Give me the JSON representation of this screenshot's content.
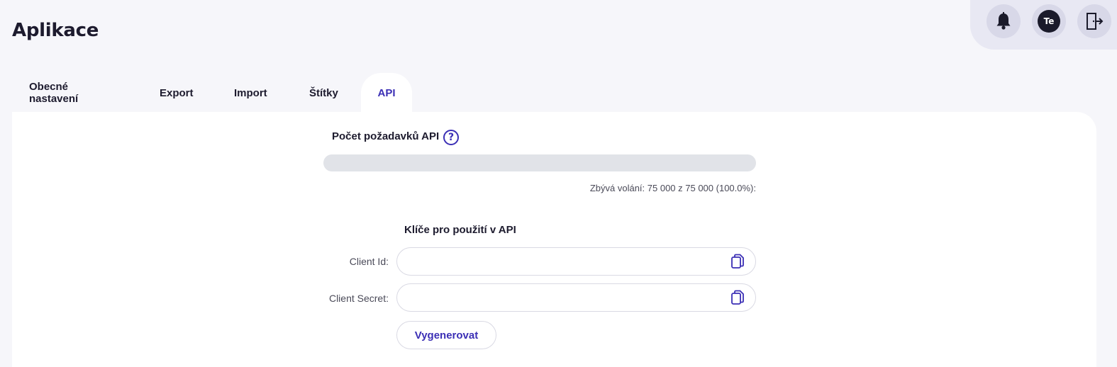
{
  "page": {
    "title": "Aplikace"
  },
  "header": {
    "user_initials": "Te",
    "icons": [
      "bell-icon",
      "avatar",
      "logout-icon"
    ]
  },
  "tabs": [
    {
      "label": "Obecné nastavení",
      "active": false
    },
    {
      "label": "Export",
      "active": false
    },
    {
      "label": "Import",
      "active": false
    },
    {
      "label": "Štítky",
      "active": false
    },
    {
      "label": "API",
      "active": true
    }
  ],
  "api": {
    "requests_label": "Počet požadavků API",
    "help_symbol": "?",
    "usage_text": "Zbývá volání: 75 000 z 75 000 (100.0%):",
    "used_fraction": 0.0,
    "keys_title": "Klíče pro použití v API",
    "client_id_label": "Client Id:",
    "client_id_value": "",
    "client_secret_label": "Client Secret:",
    "client_secret_value": "",
    "generate_label": "Vygenerovat"
  },
  "colors": {
    "accent": "#3b2fb5",
    "background": "#f6f6fa",
    "panel": "#ffffff",
    "track": "#e1e3e8"
  }
}
